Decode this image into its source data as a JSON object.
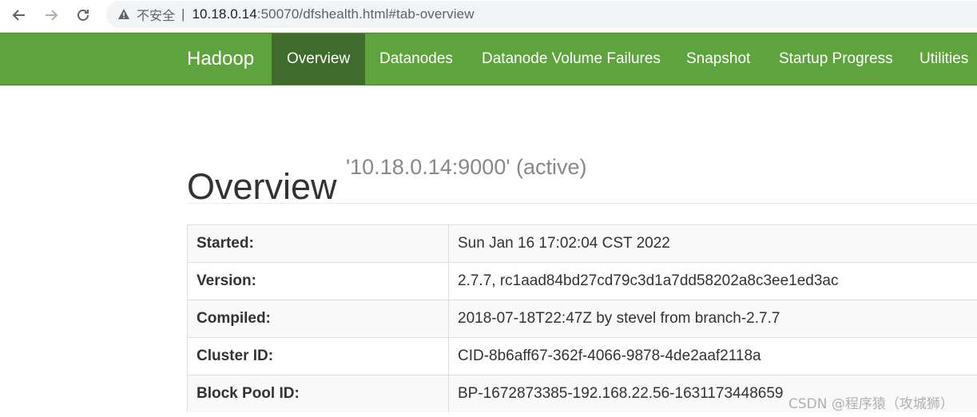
{
  "browser": {
    "insecure_label": "不安全",
    "separator": "|",
    "url_host": "10.18.0.14",
    "url_rest": ":50070/dfshealth.html#tab-overview",
    "back_icon": "arrow-left-icon",
    "forward_icon": "arrow-right-icon",
    "reload_icon": "reload-icon",
    "warning_icon": "warning-triangle-icon"
  },
  "navbar": {
    "brand": "Hadoop",
    "items": [
      {
        "label": "Overview",
        "active": true
      },
      {
        "label": "Datanodes",
        "active": false
      },
      {
        "label": "Datanode Volume Failures",
        "active": false
      },
      {
        "label": "Snapshot",
        "active": false
      },
      {
        "label": "Startup Progress",
        "active": false
      },
      {
        "label": "Utilities",
        "active": false
      }
    ],
    "color": "#5fa33e",
    "active_color": "#3f6b2c"
  },
  "header": {
    "title": "Overview",
    "subtitle": "'10.18.0.14:9000' (active)"
  },
  "overview_table": [
    {
      "key": "Started:",
      "value": "Sun Jan 16 17:02:04 CST 2022"
    },
    {
      "key": "Version:",
      "value": "2.7.7, rc1aad84bd27cd79c3d1a7dd58202a8c3ee1ed3ac"
    },
    {
      "key": "Compiled:",
      "value": "2018-07-18T22:47Z by stevel from branch-2.7.7"
    },
    {
      "key": "Cluster ID:",
      "value": "CID-8b6aff67-362f-4066-9878-4de2aaf2118a"
    },
    {
      "key": "Block Pool ID:",
      "value": "BP-1672873385-192.168.22.56-1631173448659"
    }
  ],
  "watermark": "CSDN @程序猿（攻城狮）"
}
